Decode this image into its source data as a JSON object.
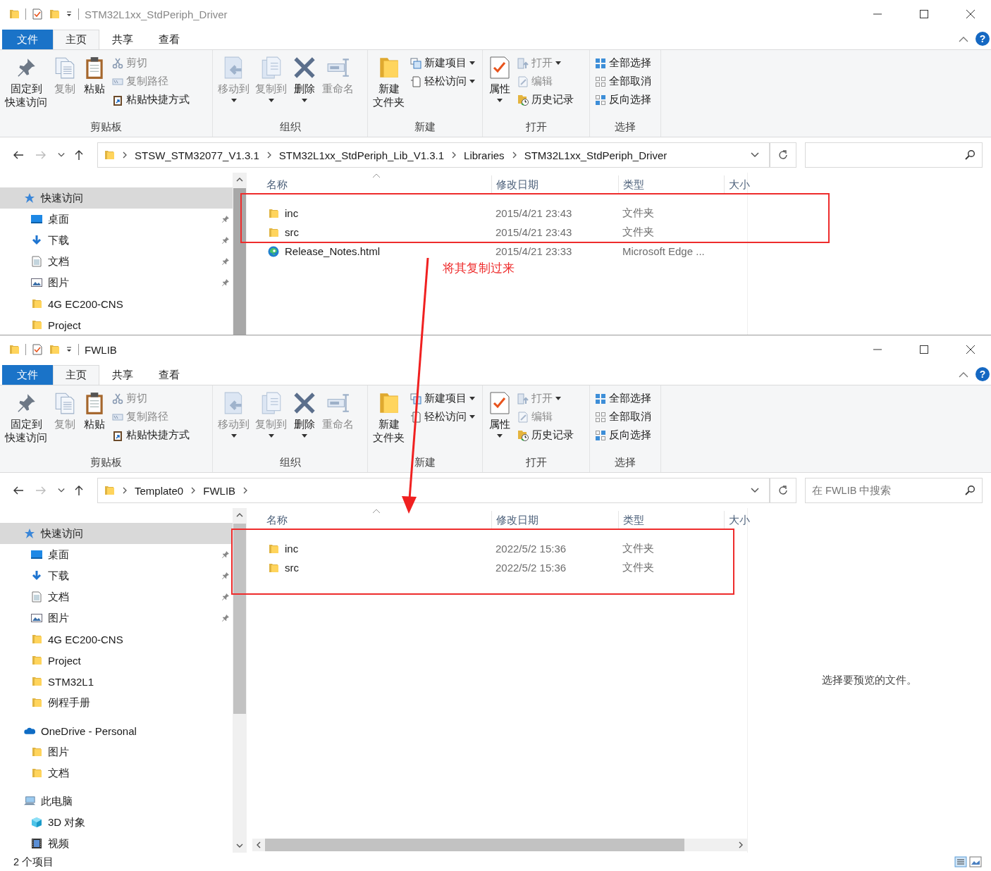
{
  "windows": [
    {
      "title": "STM32L1xx_StdPeriph_Driver",
      "active": false,
      "help": "?",
      "tabs": [
        {
          "label": "文件",
          "kind": "file",
          "selected": false
        },
        {
          "label": "主页",
          "kind": "tab",
          "selected": true
        },
        {
          "label": "共享",
          "kind": "tab",
          "selected": false
        },
        {
          "label": "查看",
          "kind": "tab",
          "selected": false
        }
      ],
      "ribbon": [
        {
          "label": "剪贴板",
          "items": [
            {
              "kind": "large",
              "lines": [
                "固定到",
                "快速访问"
              ],
              "disabled": false,
              "dropdown": false
            },
            {
              "kind": "large",
              "lines": [
                "复制"
              ],
              "disabled": true,
              "dropdown": false
            },
            {
              "kind": "large",
              "lines": [
                "粘贴"
              ],
              "disabled": false,
              "dropdown": false
            },
            {
              "kind": "small",
              "lines": [
                "剪切"
              ],
              "disabled": true,
              "dropdown": false
            },
            {
              "kind": "small",
              "lines": [
                "复制路径"
              ],
              "disabled": true,
              "dropdown": false
            },
            {
              "kind": "small",
              "lines": [
                "粘贴快捷方式"
              ],
              "disabled": false,
              "dropdown": false
            }
          ]
        },
        {
          "label": "组织",
          "items": [
            {
              "kind": "large",
              "lines": [
                "移动到"
              ],
              "disabled": true,
              "dropdown": true
            },
            {
              "kind": "large",
              "lines": [
                "复制到"
              ],
              "disabled": true,
              "dropdown": true
            },
            {
              "kind": "large",
              "lines": [
                "删除"
              ],
              "disabled": false,
              "dropdown": true
            },
            {
              "kind": "large",
              "lines": [
                "重命名"
              ],
              "disabled": true,
              "dropdown": false
            }
          ]
        },
        {
          "label": "新建",
          "items": [
            {
              "kind": "large",
              "lines": [
                "新建",
                "文件夹"
              ],
              "disabled": false,
              "dropdown": false
            },
            {
              "kind": "small",
              "lines": [
                "新建项目"
              ],
              "disabled": false,
              "dropdown": true
            },
            {
              "kind": "small",
              "lines": [
                "轻松访问"
              ],
              "disabled": false,
              "dropdown": true
            }
          ]
        },
        {
          "label": "打开",
          "items": [
            {
              "kind": "large",
              "lines": [
                "属性"
              ],
              "disabled": false,
              "dropdown": true
            },
            {
              "kind": "small",
              "lines": [
                "打开"
              ],
              "disabled": true,
              "dropdown": true
            },
            {
              "kind": "small",
              "lines": [
                "编辑"
              ],
              "disabled": true,
              "dropdown": false
            },
            {
              "kind": "small",
              "lines": [
                "历史记录"
              ],
              "disabled": false,
              "dropdown": false
            }
          ]
        },
        {
          "label": "选择",
          "items": [
            {
              "kind": "small",
              "lines": [
                "全部选择"
              ],
              "disabled": false,
              "dropdown": false
            },
            {
              "kind": "small",
              "lines": [
                "全部取消"
              ],
              "disabled": false,
              "dropdown": false
            },
            {
              "kind": "small",
              "lines": [
                "反向选择"
              ],
              "disabled": false,
              "dropdown": false
            }
          ]
        }
      ],
      "address": {
        "crumbs": [
          "STSW_STM32077_V1.3.1",
          "STM32L1xx_StdPeriph_Lib_V1.3.1",
          "Libraries",
          "STM32L1xx_StdPeriph_Driver"
        ],
        "trailing_chevron": false
      },
      "nav": [
        {
          "label": "快速访问",
          "kind": "quick-access",
          "selected": true,
          "pinned": false,
          "children": [
            {
              "label": "桌面",
              "kind": "desktop",
              "selected": false,
              "pinned": true
            },
            {
              "label": "下载",
              "kind": "downloads",
              "selected": false,
              "pinned": true
            },
            {
              "label": "文档",
              "kind": "documents",
              "selected": false,
              "pinned": true
            },
            {
              "label": "图片",
              "kind": "pictures",
              "selected": false,
              "pinned": true
            },
            {
              "label": "4G EC200-CNS",
              "kind": "folder",
              "selected": false,
              "pinned": false
            },
            {
              "label": "Project",
              "kind": "folder",
              "selected": false,
              "pinned": false
            }
          ]
        }
      ],
      "columns": [
        "名称",
        "修改日期",
        "类型",
        "大小"
      ],
      "rows": [
        {
          "name": "inc",
          "date": "2015/4/21 23:43",
          "type": "文件夹",
          "kind": "folder"
        },
        {
          "name": "src",
          "date": "2015/4/21 23:43",
          "type": "文件夹",
          "kind": "folder"
        },
        {
          "name": "Release_Notes.html",
          "date": "2015/4/21 23:33",
          "type": "Microsoft Edge ...",
          "kind": "html"
        }
      ],
      "highlight": true
    },
    {
      "title": "FWLIB",
      "active": true,
      "help": "?",
      "tabs": [
        {
          "label": "文件",
          "kind": "file",
          "selected": false
        },
        {
          "label": "主页",
          "kind": "tab",
          "selected": true
        },
        {
          "label": "共享",
          "kind": "tab",
          "selected": false
        },
        {
          "label": "查看",
          "kind": "tab",
          "selected": false
        }
      ],
      "ribbon": [
        {
          "label": "剪贴板",
          "items": [
            {
              "kind": "large",
              "lines": [
                "固定到",
                "快速访问"
              ],
              "disabled": false,
              "dropdown": false
            },
            {
              "kind": "large",
              "lines": [
                "复制"
              ],
              "disabled": true,
              "dropdown": false
            },
            {
              "kind": "large",
              "lines": [
                "粘贴"
              ],
              "disabled": false,
              "dropdown": false
            },
            {
              "kind": "small",
              "lines": [
                "剪切"
              ],
              "disabled": true,
              "dropdown": false
            },
            {
              "kind": "small",
              "lines": [
                "复制路径"
              ],
              "disabled": true,
              "dropdown": false
            },
            {
              "kind": "small",
              "lines": [
                "粘贴快捷方式"
              ],
              "disabled": false,
              "dropdown": false
            }
          ]
        },
        {
          "label": "组织",
          "items": [
            {
              "kind": "large",
              "lines": [
                "移动到"
              ],
              "disabled": true,
              "dropdown": true
            },
            {
              "kind": "large",
              "lines": [
                "复制到"
              ],
              "disabled": true,
              "dropdown": true
            },
            {
              "kind": "large",
              "lines": [
                "删除"
              ],
              "disabled": false,
              "dropdown": true
            },
            {
              "kind": "large",
              "lines": [
                "重命名"
              ],
              "disabled": true,
              "dropdown": false
            }
          ]
        },
        {
          "label": "新建",
          "items": [
            {
              "kind": "large",
              "lines": [
                "新建",
                "文件夹"
              ],
              "disabled": false,
              "dropdown": false
            },
            {
              "kind": "small",
              "lines": [
                "新建项目"
              ],
              "disabled": false,
              "dropdown": true
            },
            {
              "kind": "small",
              "lines": [
                "轻松访问"
              ],
              "disabled": false,
              "dropdown": true
            }
          ]
        },
        {
          "label": "打开",
          "items": [
            {
              "kind": "large",
              "lines": [
                "属性"
              ],
              "disabled": false,
              "dropdown": true
            },
            {
              "kind": "small",
              "lines": [
                "打开"
              ],
              "disabled": true,
              "dropdown": true
            },
            {
              "kind": "small",
              "lines": [
                "编辑"
              ],
              "disabled": true,
              "dropdown": false
            },
            {
              "kind": "small",
              "lines": [
                "历史记录"
              ],
              "disabled": false,
              "dropdown": false
            }
          ]
        },
        {
          "label": "选择",
          "items": [
            {
              "kind": "small",
              "lines": [
                "全部选择"
              ],
              "disabled": false,
              "dropdown": false
            },
            {
              "kind": "small",
              "lines": [
                "全部取消"
              ],
              "disabled": false,
              "dropdown": false
            },
            {
              "kind": "small",
              "lines": [
                "反向选择"
              ],
              "disabled": false,
              "dropdown": false
            }
          ]
        }
      ],
      "address": {
        "crumbs": [
          "Template0",
          "FWLIB"
        ],
        "trailing_chevron": true
      },
      "search": {
        "placeholder": "在 FWLIB 中搜索"
      },
      "nav": [
        {
          "label": "快速访问",
          "kind": "quick-access",
          "selected": true,
          "pinned": false,
          "children": [
            {
              "label": "桌面",
              "kind": "desktop",
              "selected": false,
              "pinned": true
            },
            {
              "label": "下载",
              "kind": "downloads",
              "selected": false,
              "pinned": true
            },
            {
              "label": "文档",
              "kind": "documents",
              "selected": false,
              "pinned": true
            },
            {
              "label": "图片",
              "kind": "pictures",
              "selected": false,
              "pinned": true
            },
            {
              "label": "4G EC200-CNS",
              "kind": "folder",
              "selected": false,
              "pinned": false
            },
            {
              "label": "Project",
              "kind": "folder",
              "selected": false,
              "pinned": false
            },
            {
              "label": "STM32L1",
              "kind": "folder",
              "selected": false,
              "pinned": false
            },
            {
              "label": "例程手册",
              "kind": "folder",
              "selected": false,
              "pinned": false
            }
          ]
        },
        {
          "label": "OneDrive - Personal",
          "kind": "onedrive",
          "selected": false,
          "pinned": false,
          "children": [
            {
              "label": "图片",
              "kind": "folder",
              "selected": false,
              "pinned": false
            },
            {
              "label": "文档",
              "kind": "folder",
              "selected": false,
              "pinned": false
            }
          ]
        },
        {
          "label": "此电脑",
          "kind": "this-pc",
          "selected": false,
          "pinned": false,
          "children": [
            {
              "label": "3D 对象",
              "kind": "objects",
              "selected": false,
              "pinned": false
            },
            {
              "label": "视频",
              "kind": "videos",
              "selected": false,
              "pinned": false
            }
          ]
        }
      ],
      "columns": [
        "名称",
        "修改日期",
        "类型",
        "大小"
      ],
      "rows": [
        {
          "name": "inc",
          "date": "2022/5/2 15:36",
          "type": "文件夹",
          "kind": "folder"
        },
        {
          "name": "src",
          "date": "2022/5/2 15:36",
          "type": "文件夹",
          "kind": "folder"
        }
      ],
      "highlight": true,
      "preview": "选择要预览的文件。",
      "status": "2 个项目"
    }
  ],
  "annotation": {
    "note": "将其复制过来"
  }
}
